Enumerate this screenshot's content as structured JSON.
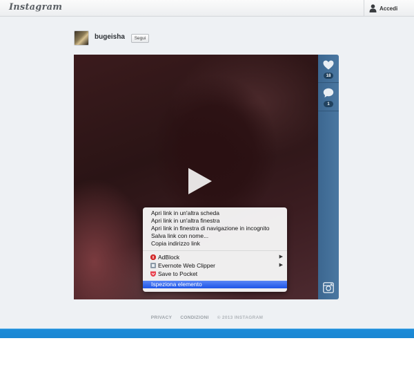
{
  "header": {
    "logo": "Instagram",
    "login_label": "Accedi"
  },
  "post": {
    "username": "bugeisha",
    "follow_label": "Segui",
    "likes_count": "18",
    "comments_count": "1"
  },
  "context_menu": {
    "items": [
      "Apri link in un'altra scheda",
      "Apri link in un'altra finestra",
      "Apri link in finestra di navigazione in incognito",
      "Salva link con nome...",
      "Copia indirizzo link"
    ],
    "extensions": [
      {
        "label": "AdBlock",
        "icon": "adblock-icon",
        "submenu": true,
        "color": "#d32f2f"
      },
      {
        "label": "Evernote Web Clipper",
        "icon": "evernote-icon",
        "submenu": true,
        "color": "#7a8a99"
      },
      {
        "label": "Save to Pocket",
        "icon": "pocket-icon",
        "submenu": false,
        "color": "#e8424f"
      }
    ],
    "selected": "Ispeziona elemento"
  },
  "footer": {
    "privacy": "PRIVACY",
    "terms": "CONDIZIONI",
    "copyright": "© 2013 INSTAGRAM"
  },
  "colors": {
    "sidebar": "#4a77a1",
    "bottom_bar": "#1a86d2",
    "menu_highlight": "#2a62ee"
  }
}
